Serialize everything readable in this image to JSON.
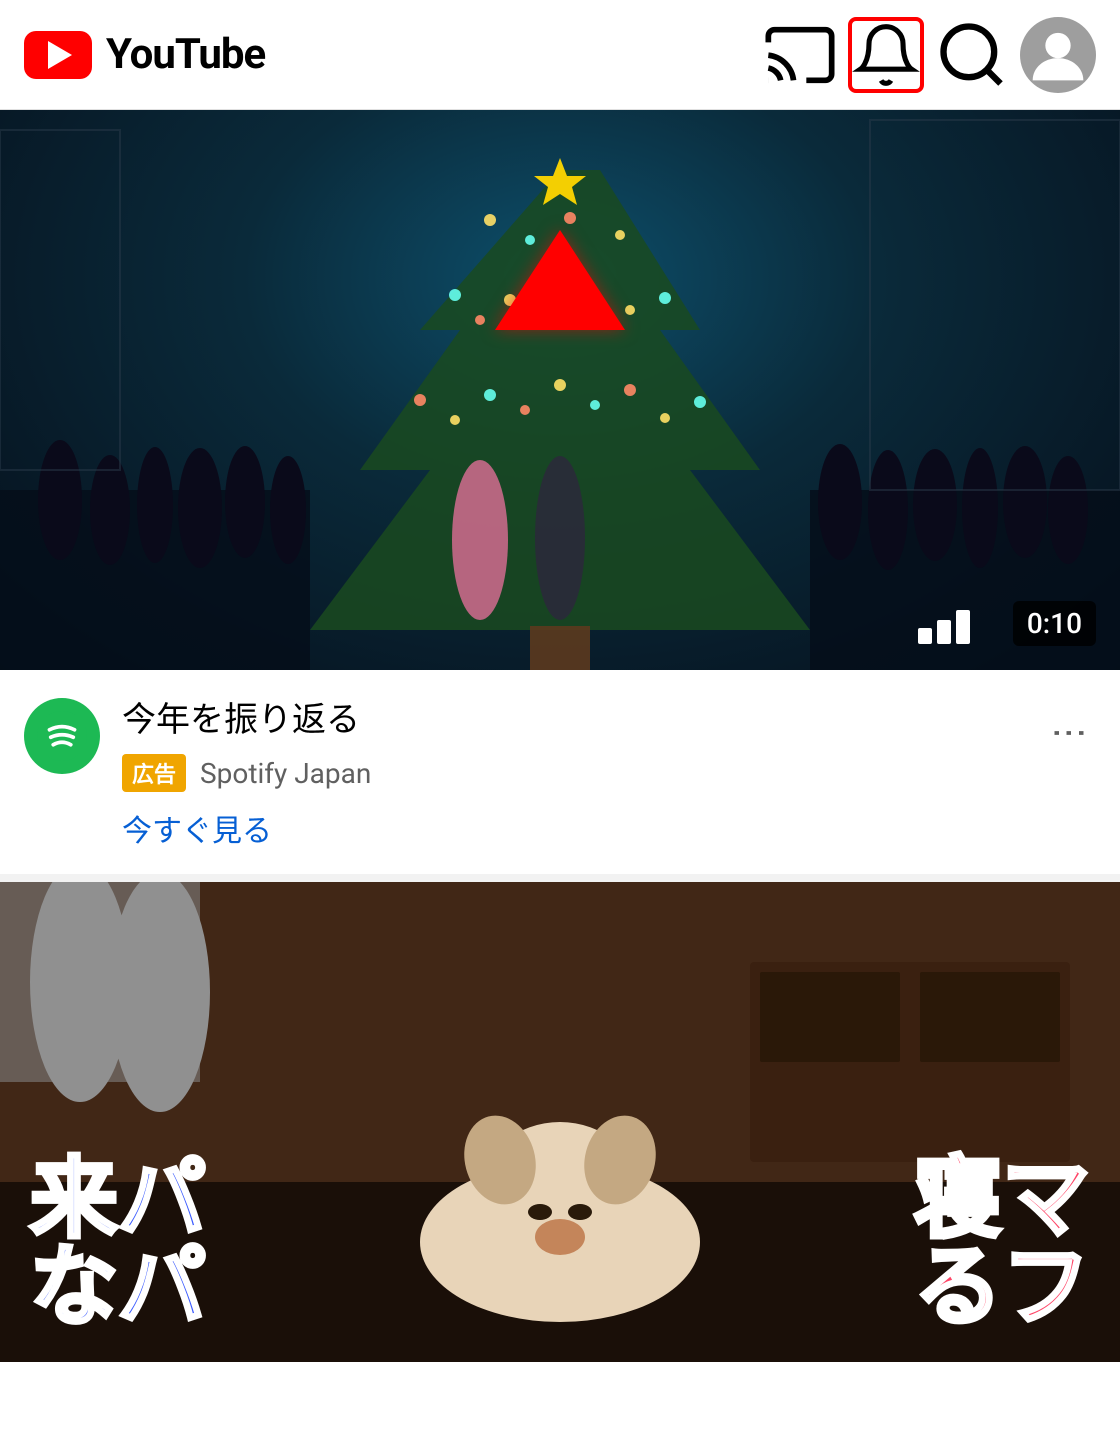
{
  "header": {
    "title": "YouTube",
    "icons": {
      "cast": "cast-icon",
      "bell": "bell-icon",
      "search": "search-icon",
      "account": "account-icon"
    },
    "bell_highlighted": true
  },
  "video1": {
    "duration": "0:10",
    "arrow_annotation": "up-arrow"
  },
  "video_info": {
    "channel_avatar_type": "spotify",
    "title": "今年を振り返る",
    "ad_label": "広告",
    "channel_name": "Spotify Japan",
    "cta_text": "今すぐ見る",
    "more_button": "⋮"
  },
  "video2": {
    "jp_text_left_line1": "来パ",
    "jp_text_left_line2": "なパ",
    "jp_text_right_line1": "寝マ",
    "jp_text_right_line2": "るフ"
  },
  "colors": {
    "youtube_red": "#FF0000",
    "spotify_green": "#1DB954",
    "bell_border": "#FF0000",
    "ad_badge": "#f0a500",
    "cta_blue": "#065fd4",
    "arrow_red": "#FF0000"
  }
}
